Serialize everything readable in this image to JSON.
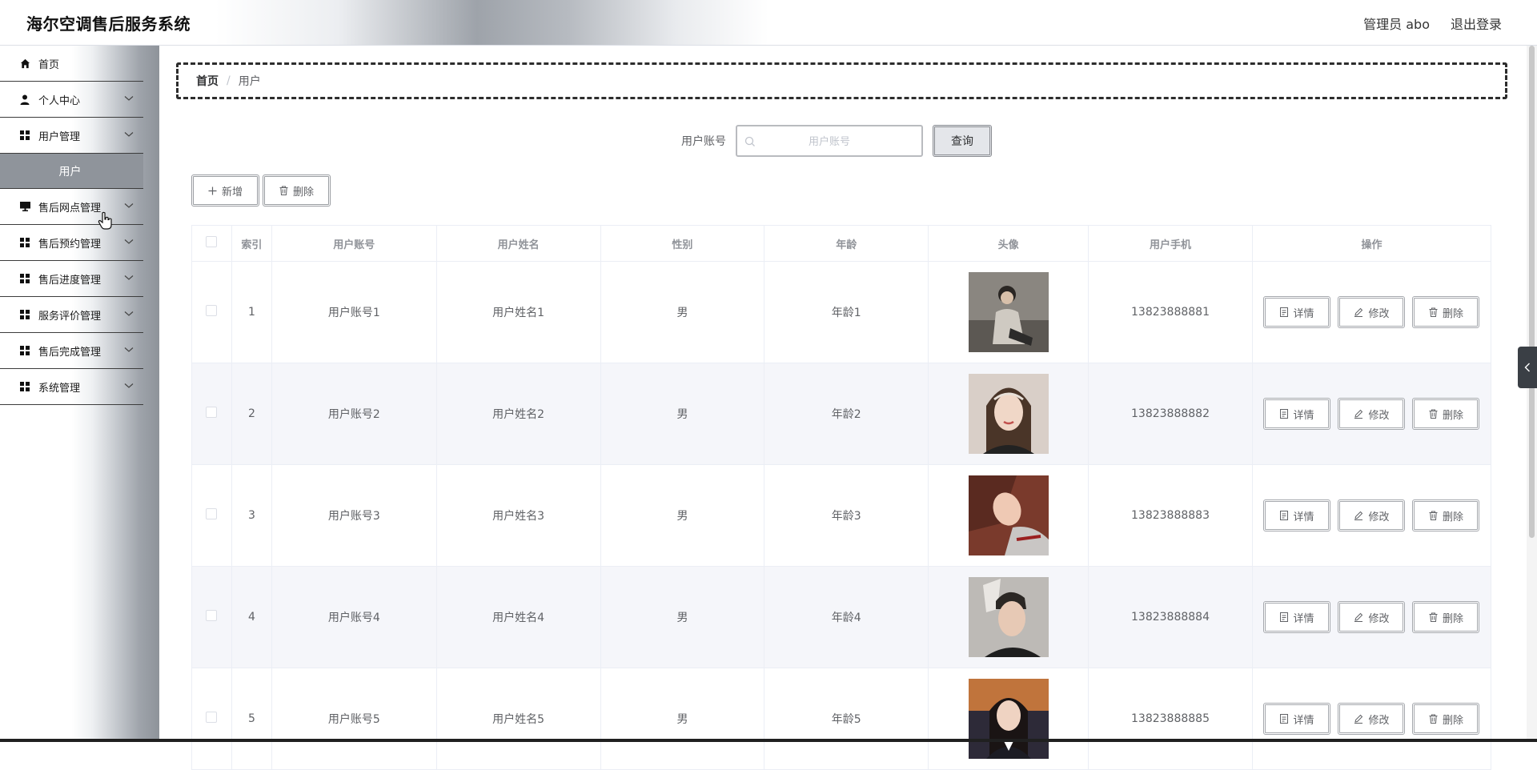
{
  "app": {
    "title": "海尔空调售后服务系统",
    "admin_label": "管理员 abo",
    "logout_label": "退出登录"
  },
  "sidebar": {
    "items": [
      {
        "label": "首页",
        "icon": "home-icon"
      },
      {
        "label": "个人中心",
        "icon": "user-icon"
      },
      {
        "label": "用户管理",
        "icon": "grid-icon"
      },
      {
        "label": "售后网点管理",
        "icon": "monitor-icon"
      },
      {
        "label": "售后预约管理",
        "icon": "grid-icon"
      },
      {
        "label": "售后进度管理",
        "icon": "grid-icon"
      },
      {
        "label": "服务评价管理",
        "icon": "grid-icon"
      },
      {
        "label": "售后完成管理",
        "icon": "grid-icon"
      },
      {
        "label": "系统管理",
        "icon": "grid-icon"
      }
    ],
    "active_sub": "用户"
  },
  "breadcrumb": {
    "home": "首页",
    "separator": "/",
    "current": "用户"
  },
  "search": {
    "label": "用户账号",
    "placeholder": "用户账号",
    "button": "查询"
  },
  "toolbar": {
    "add_label": "新增",
    "delete_label": "删除"
  },
  "table": {
    "headers": [
      "索引",
      "用户账号",
      "用户姓名",
      "性别",
      "年龄",
      "头像",
      "用户手机",
      "操作"
    ],
    "rows": [
      {
        "index": "1",
        "account": "用户账号1",
        "name": "用户姓名1",
        "gender": "男",
        "age": "年龄1",
        "phone": "13823888881"
      },
      {
        "index": "2",
        "account": "用户账号2",
        "name": "用户姓名2",
        "gender": "男",
        "age": "年龄2",
        "phone": "13823888882"
      },
      {
        "index": "3",
        "account": "用户账号3",
        "name": "用户姓名3",
        "gender": "男",
        "age": "年龄3",
        "phone": "13823888883"
      },
      {
        "index": "4",
        "account": "用户账号4",
        "name": "用户姓名4",
        "gender": "男",
        "age": "年龄4",
        "phone": "13823888884"
      },
      {
        "index": "5",
        "account": "用户账号5",
        "name": "用户姓名5",
        "gender": "男",
        "age": "年龄5",
        "phone": "13823888885"
      }
    ],
    "actions": {
      "detail": "详情",
      "edit": "修改",
      "delete": "删除"
    }
  },
  "colors": {
    "active_menu_bg": "#8f949b",
    "stripe_bg": "#f5f6fa",
    "side_toggle": "#3a3f45"
  }
}
